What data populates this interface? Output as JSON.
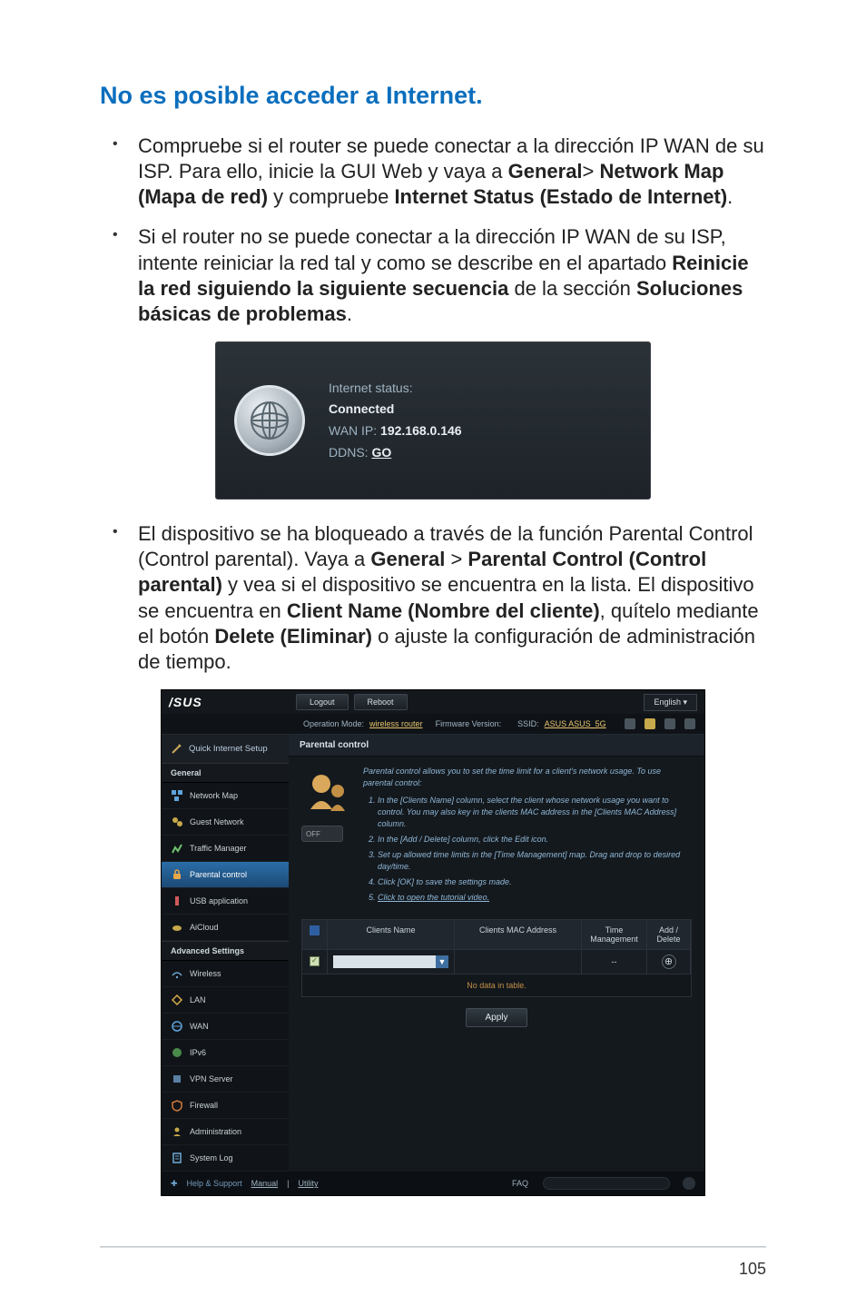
{
  "heading": "No es posible acceder a Internet.",
  "bullets": {
    "b1_pre": "Compruebe si el router se puede conectar a la dirección IP WAN de su ISP. Para ello, inicie la GUI Web y vaya a ",
    "b1_bold1": "General",
    "b1_gt": "> ",
    "b1_bold2": "Network Map (Mapa de red)",
    "b1_mid": " y compruebe ",
    "b1_bold3": "Internet Status (Estado de Internet)",
    "b1_end": ".",
    "b2_pre": "Si el router no se puede conectar a la dirección IP WAN de su ISP, intente reiniciar la red tal y como se describe en el apartado ",
    "b2_bold1": "Reinicie la red siguiendo la siguiente secuencia",
    "b2_mid": " de la sección ",
    "b2_bold2": "Soluciones básicas de problemas",
    "b2_end": ".",
    "b3_pre": "El dispositivo se ha bloqueado a través de la función Parental Control (Control parental). Vaya a ",
    "b3_bold1": "General",
    "b3_gt": " > ",
    "b3_bold2": "Parental Control (Control parental)",
    "b3_mid1": " y vea si el dispositivo se encuentra en la lista. El dispositivo se encuentra en ",
    "b3_bold3": "Client Name (Nombre del cliente)",
    "b3_mid2": ", quítelo mediante el botón ",
    "b3_bold4": "Delete (Eliminar)",
    "b3_end": " o ajuste la configuración de administración de tiempo."
  },
  "status_card": {
    "label": "Internet status:",
    "value": "Connected",
    "wan_label": "WAN IP: ",
    "wan_value": "192.168.0.146",
    "ddns_label": "DDNS: ",
    "ddns_link": "GO"
  },
  "ui": {
    "brand": "/SUS",
    "logout": "Logout",
    "reboot": "Reboot",
    "language": "English",
    "opmode_label": "Operation Mode: ",
    "opmode_value": "wireless router",
    "fwv_label": "Firmware Version:",
    "ssid_label": "SSID: ",
    "ssid_value": "ASUS ASUS_5G",
    "qis": "Quick Internet Setup",
    "section_general": "General",
    "section_advanced": "Advanced Settings",
    "nav": {
      "network_map": "Network Map",
      "guest_network": "Guest Network",
      "traffic_manager": "Traffic Manager",
      "parental_control": "Parental control",
      "usb_application": "USB application",
      "aicloud": "AiCloud",
      "wireless": "Wireless",
      "lan": "LAN",
      "wan": "WAN",
      "ipv6": "IPv6",
      "vpn_server": "VPN Server",
      "firewall": "Firewall",
      "administration": "Administration",
      "system_log": "System Log"
    },
    "tab_title": "Parental control",
    "desc_intro": "Parental control allows you to set the time limit for a client's network usage. To use parental control:",
    "steps": {
      "s1": "In the [Clients Name] column, select the client whose network usage you want to control. You may also key in the clients MAC address in the [Clients MAC Address] column.",
      "s2": "In the [Add / Delete] column, click the Edit icon.",
      "s3": "Set up allowed time limits in the [Time Management] map. Drag and drop to desired day/time.",
      "s4": "Click [OK] to save the settings made.",
      "s5": "Click to open the tutorial video."
    },
    "toggle": "OFF",
    "grid": {
      "h_name": "Clients Name",
      "h_mac": "Clients MAC Address",
      "h_time": "Time Management",
      "h_add": "Add / Delete",
      "time_dash": "--",
      "nodata": "No data in table."
    },
    "apply": "Apply",
    "footer_help": "Help & Support",
    "footer_manual": "Manual",
    "footer_utility": "Utility",
    "footer_faq": "FAQ"
  },
  "page_number": "105"
}
